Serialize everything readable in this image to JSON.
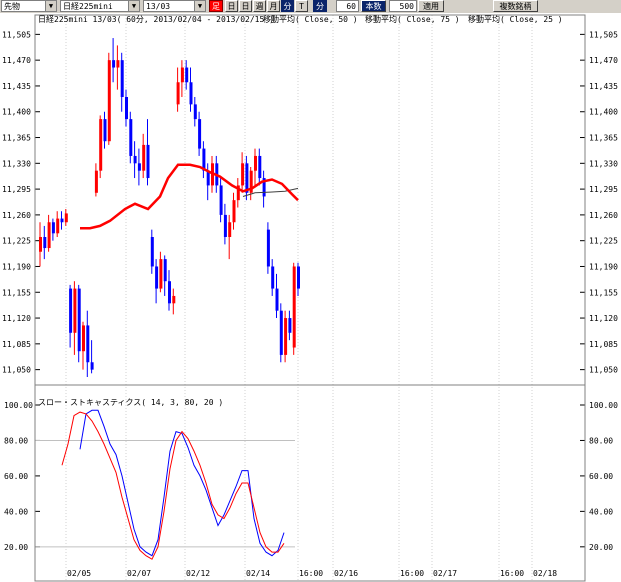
{
  "toolbar": {
    "market": "先物",
    "symbol": "日経225mini",
    "contract": "13/03",
    "btn_ashi": "足",
    "btn_day_ashi": "日",
    "btn_day": "日",
    "btn_week": "週",
    "btn_month": "月",
    "btn_minute": "分",
    "btn_tick": "T",
    "btn_minute2": "分",
    "interval_value": "60",
    "btn_honsu": "本数",
    "bars_value": "500",
    "btn_apply": "適用",
    "btn_multi": "複数銘柄"
  },
  "header": {
    "title": "日経225mini 13/03( 60分, 2013/02/04 - 2013/02/15 )",
    "ma50": "移動平均( Close, 50 )",
    "ma75": "移動平均( Close, 75 )",
    "ma25": "移動平均( Close, 25 )"
  },
  "stoch_title": "スロー・ストキャスティクス( 14, 3, 80, 20 )",
  "colors": {
    "up": "#ff0000",
    "down": "#0000ff",
    "ma_red": "#ff0000",
    "ma_dark": "#404040",
    "stoch_k": "#0000ff",
    "stoch_d": "#ff0000",
    "grid": "#c0c0c0"
  },
  "chart_data": [
    {
      "type": "candlestick",
      "title": "日経225mini 13/03( 60分, 2013/02/04 - 2013/02/15 )",
      "ylim": [
        11040,
        11515
      ],
      "y_ticks": [
        "11,505",
        "11,470",
        "11,435",
        "11,400",
        "11,365",
        "11,330",
        "11,295",
        "11,260",
        "11,225",
        "11,190",
        "11,155",
        "11,120",
        "11,085",
        "11,050"
      ],
      "x_ticks": [
        "02/05",
        "02/07",
        "02/12",
        "02/14",
        "16:00",
        "02/16",
        "16:00",
        "02/17",
        "16:00",
        "02/18"
      ],
      "bars": [
        [
          11210,
          11250,
          11190,
          11230
        ],
        [
          11230,
          11245,
          11200,
          11215
        ],
        [
          11215,
          11260,
          11210,
          11250
        ],
        [
          11250,
          11255,
          11225,
          11235
        ],
        [
          11235,
          11265,
          11230,
          11255
        ],
        [
          11255,
          11265,
          11240,
          11250
        ],
        [
          11250,
          11268,
          11245,
          11262
        ],
        [
          11160,
          11165,
          11080,
          11100
        ],
        [
          11100,
          11170,
          11070,
          11160
        ],
        [
          11160,
          11165,
          11060,
          11075
        ],
        [
          11075,
          11115,
          11050,
          11110
        ],
        [
          11110,
          11130,
          11040,
          11060
        ],
        [
          11060,
          11090,
          11045,
          11050
        ],
        [
          11290,
          11330,
          11285,
          11320
        ],
        [
          11320,
          11395,
          11310,
          11390
        ],
        [
          11390,
          11400,
          11350,
          11360
        ],
        [
          11360,
          11480,
          11355,
          11470
        ],
        [
          11470,
          11500,
          11440,
          11460
        ],
        [
          11460,
          11490,
          11430,
          11470
        ],
        [
          11470,
          11480,
          11400,
          11420
        ],
        [
          11420,
          11430,
          11380,
          11390
        ],
        [
          11390,
          11400,
          11330,
          11340
        ],
        [
          11340,
          11360,
          11310,
          11330
        ],
        [
          11330,
          11350,
          11300,
          11320
        ],
        [
          11320,
          11370,
          11310,
          11355
        ],
        [
          11355,
          11390,
          11300,
          11310
        ],
        [
          11230,
          11240,
          11180,
          11190
        ],
        [
          11190,
          11200,
          11140,
          11160
        ],
        [
          11160,
          11210,
          11155,
          11200
        ],
        [
          11200,
          11205,
          11150,
          11170
        ],
        [
          11170,
          11185,
          11130,
          11140
        ],
        [
          11140,
          11160,
          11125,
          11150
        ],
        [
          11410,
          11460,
          11400,
          11440
        ],
        [
          11440,
          11470,
          11420,
          11460
        ],
        [
          11460,
          11470,
          11430,
          11440
        ],
        [
          11440,
          11460,
          11400,
          11410
        ],
        [
          11410,
          11420,
          11380,
          11390
        ],
        [
          11390,
          11400,
          11340,
          11350
        ],
        [
          11350,
          11360,
          11310,
          11320
        ],
        [
          11320,
          11330,
          11280,
          11300
        ],
        [
          11300,
          11340,
          11290,
          11330
        ],
        [
          11330,
          11340,
          11290,
          11300
        ],
        [
          11300,
          11310,
          11250,
          11260
        ],
        [
          11260,
          11275,
          11220,
          11230
        ],
        [
          11230,
          11260,
          11200,
          11250
        ],
        [
          11250,
          11290,
          11240,
          11280
        ],
        [
          11280,
          11310,
          11270,
          11300
        ],
        [
          11300,
          11345,
          11290,
          11330
        ],
        [
          11330,
          11340,
          11280,
          11290
        ],
        [
          11290,
          11325,
          11280,
          11320
        ],
        [
          11320,
          11350,
          11300,
          11340
        ],
        [
          11340,
          11350,
          11300,
          11310
        ],
        [
          11310,
          11320,
          11270,
          11285
        ],
        [
          11240,
          11250,
          11180,
          11190
        ],
        [
          11190,
          11200,
          11150,
          11160
        ],
        [
          11160,
          11180,
          11120,
          11130
        ],
        [
          11130,
          11140,
          11060,
          11070
        ],
        [
          11070,
          11130,
          11060,
          11120
        ],
        [
          11120,
          11130,
          11090,
          11100
        ],
        [
          11080,
          11195,
          11070,
          11190
        ],
        [
          11190,
          11195,
          11150,
          11160
        ]
      ],
      "ma_red": [
        [
          80,
          11242
        ],
        [
          90,
          11242
        ],
        [
          100,
          11245
        ],
        [
          110,
          11252
        ],
        [
          125,
          11268
        ],
        [
          135,
          11275
        ],
        [
          148,
          11268
        ],
        [
          160,
          11285
        ],
        [
          168,
          11310
        ],
        [
          178,
          11328
        ],
        [
          190,
          11328
        ],
        [
          200,
          11325
        ],
        [
          210,
          11318
        ],
        [
          220,
          11312
        ],
        [
          232,
          11300
        ],
        [
          243,
          11292
        ],
        [
          252,
          11296
        ],
        [
          262,
          11305
        ],
        [
          272,
          11308
        ],
        [
          282,
          11302
        ],
        [
          292,
          11288
        ],
        [
          298,
          11280
        ]
      ],
      "ma_dark": [
        [
          243,
          11285
        ],
        [
          255,
          11290
        ],
        [
          270,
          11291
        ],
        [
          285,
          11292
        ],
        [
          298,
          11296
        ]
      ]
    },
    {
      "type": "line",
      "title": "スロー・ストキャスティクス( 14, 3, 80, 20 )",
      "ylim": [
        12,
        100
      ],
      "y_ticks": [
        "100.00",
        "80.00",
        "60.00",
        "40.00",
        "20.00"
      ],
      "reference_lines": [
        80,
        20
      ],
      "series": [
        {
          "name": "K",
          "color": "#0000ff",
          "points": [
            [
              80,
              75
            ],
            [
              86,
              95
            ],
            [
              92,
              97
            ],
            [
              98,
              97
            ],
            [
              104,
              88
            ],
            [
              110,
              78
            ],
            [
              116,
              72
            ],
            [
              122,
              60
            ],
            [
              128,
              45
            ],
            [
              134,
              30
            ],
            [
              140,
              20
            ],
            [
              146,
              17
            ],
            [
              152,
              15
            ],
            [
              158,
              24
            ],
            [
              164,
              48
            ],
            [
              170,
              74
            ],
            [
              176,
              85
            ],
            [
              182,
              84
            ],
            [
              188,
              76
            ],
            [
              194,
              66
            ],
            [
              200,
              60
            ],
            [
              206,
              52
            ],
            [
              212,
              42
            ],
            [
              218,
              32
            ],
            [
              224,
              38
            ],
            [
              230,
              46
            ],
            [
              236,
              54
            ],
            [
              242,
              63
            ],
            [
              248,
              63
            ],
            [
              254,
              36
            ],
            [
              260,
              22
            ],
            [
              266,
              17
            ],
            [
              272,
              15
            ],
            [
              278,
              18
            ],
            [
              284,
              28
            ]
          ]
        },
        {
          "name": "D",
          "color": "#ff0000",
          "points": [
            [
              62,
              66
            ],
            [
              68,
              78
            ],
            [
              74,
              94
            ],
            [
              80,
              96
            ],
            [
              86,
              95
            ],
            [
              92,
              91
            ],
            [
              98,
              85
            ],
            [
              104,
              78
            ],
            [
              110,
              70
            ],
            [
              116,
              62
            ],
            [
              122,
              48
            ],
            [
              128,
              36
            ],
            [
              134,
              24
            ],
            [
              140,
              18
            ],
            [
              146,
              15
            ],
            [
              152,
              13
            ],
            [
              158,
              20
            ],
            [
              164,
              40
            ],
            [
              170,
              64
            ],
            [
              176,
              80
            ],
            [
              182,
              85
            ],
            [
              188,
              81
            ],
            [
              194,
              74
            ],
            [
              200,
              66
            ],
            [
              206,
              56
            ],
            [
              212,
              44
            ],
            [
              218,
              38
            ],
            [
              224,
              36
            ],
            [
              230,
              42
            ],
            [
              236,
              50
            ],
            [
              242,
              56
            ],
            [
              248,
              56
            ],
            [
              254,
              42
            ],
            [
              260,
              28
            ],
            [
              266,
              20
            ],
            [
              272,
              17
            ],
            [
              278,
              17
            ],
            [
              284,
              22
            ]
          ]
        }
      ]
    }
  ]
}
